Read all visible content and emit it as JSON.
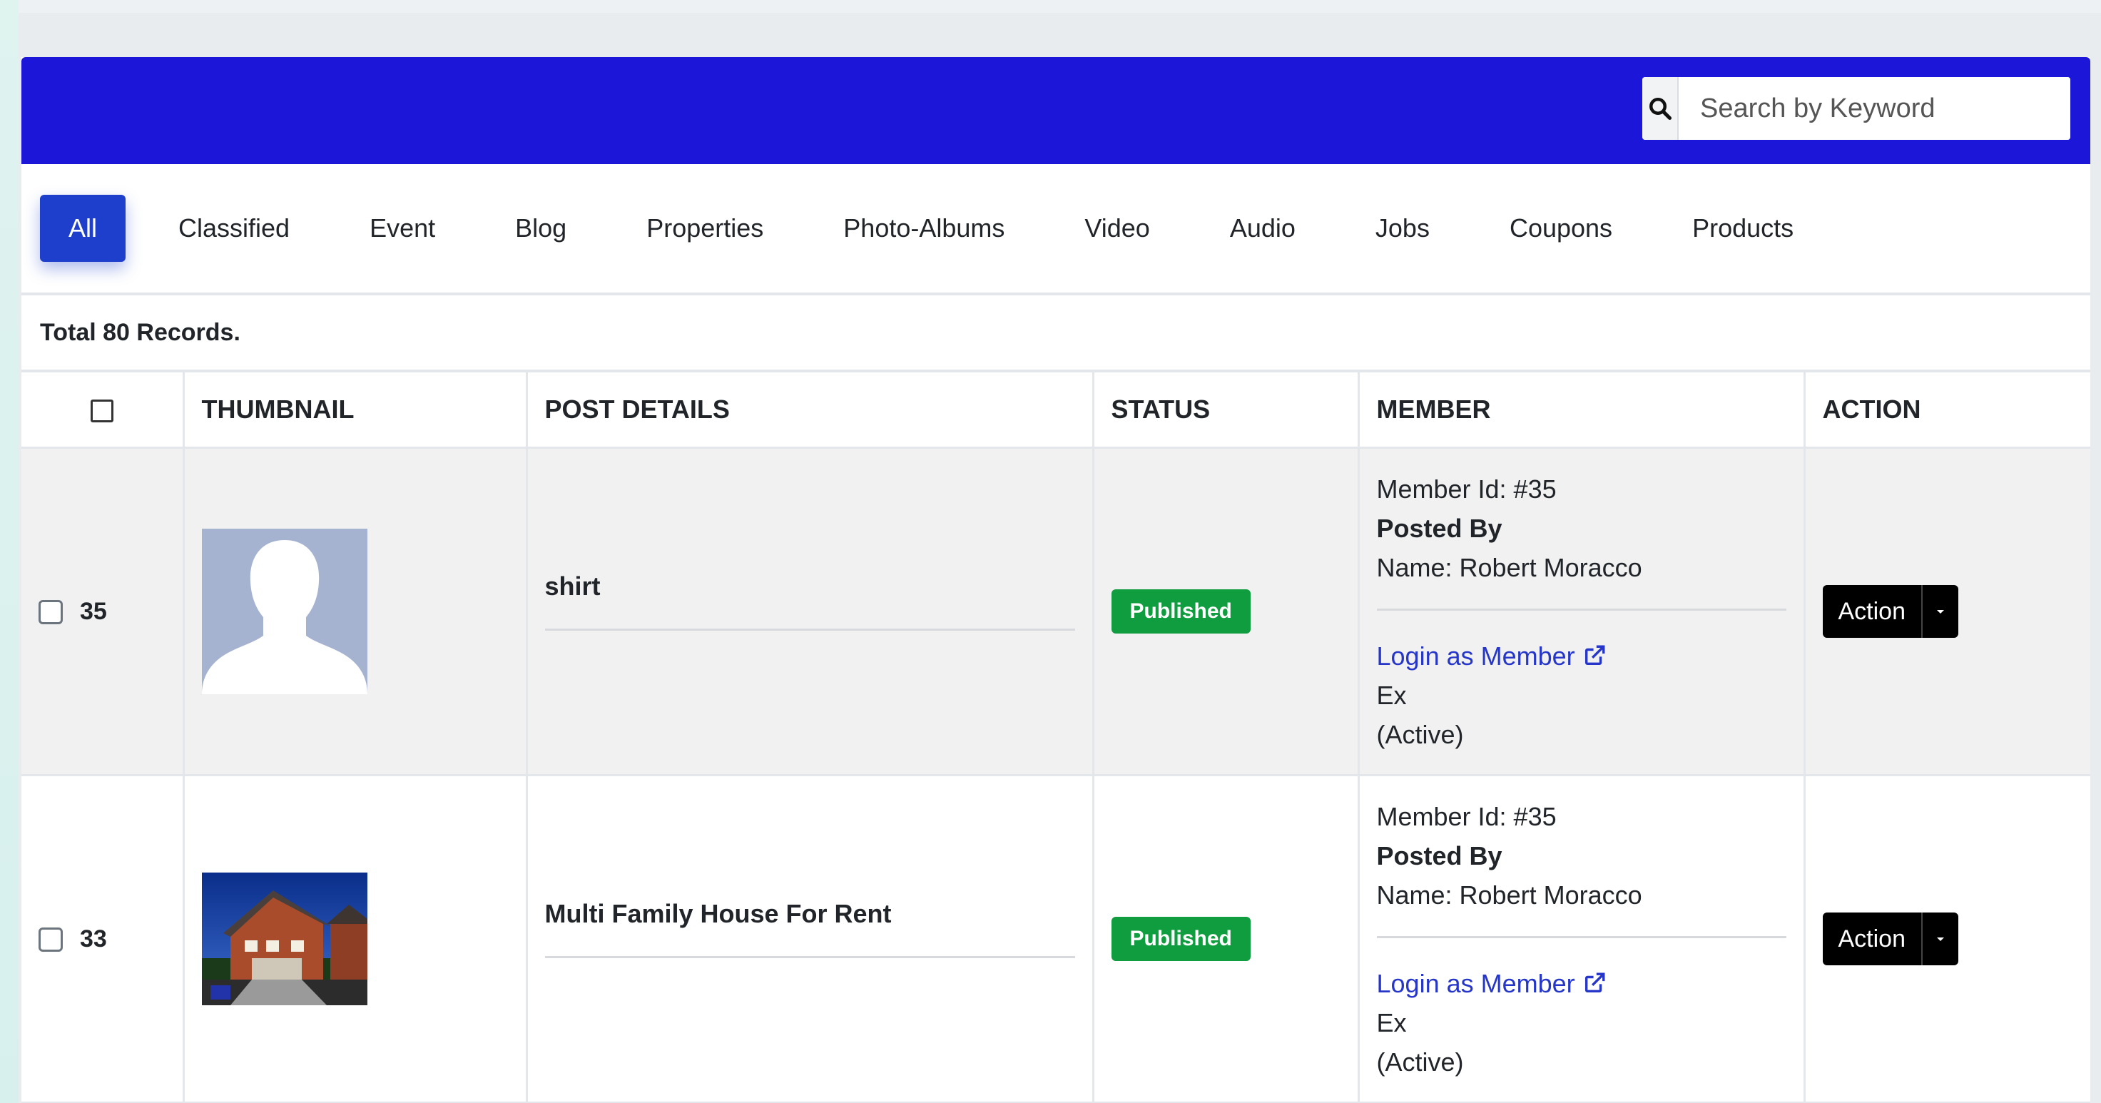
{
  "search": {
    "placeholder": "Search by Keyword"
  },
  "tabs": [
    "All",
    "Classified",
    "Event",
    "Blog",
    "Properties",
    "Photo-Albums",
    "Video",
    "Audio",
    "Jobs",
    "Coupons",
    "Products"
  ],
  "active_tab": "All",
  "total_label": "Total 80 Records.",
  "table": {
    "headers": [
      "THUMBNAIL",
      "POST DETAILS",
      "STATUS",
      "MEMBER",
      "ACTION"
    ],
    "rows": [
      {
        "id": "35",
        "thumbnail": "avatar-placeholder",
        "title": "shirt",
        "status": "Published",
        "member_id": "Member Id: #35",
        "posted_by": "Posted By",
        "name": "Name: Robert Moracco",
        "login_link": "Login as Member",
        "type": "Ex",
        "state": "(Active)",
        "action": "Action"
      },
      {
        "id": "33",
        "thumbnail": "house-photo",
        "title": "Multi Family House For Rent",
        "status": "Published",
        "member_id": "Member Id: #35",
        "posted_by": "Posted By",
        "name": "Name: Robert Moracco",
        "login_link": "Login as Member",
        "type": "Ex",
        "state": "(Active)",
        "action": "Action"
      }
    ]
  },
  "colors": {
    "header_bg": "#1c16d9",
    "active_tab": "#1e3fcc",
    "published": "#0f9d3f",
    "link": "#2536c9",
    "action_btn": "#000000"
  },
  "icons": [
    "search-icon",
    "external-link-icon",
    "caret-down-icon"
  ]
}
